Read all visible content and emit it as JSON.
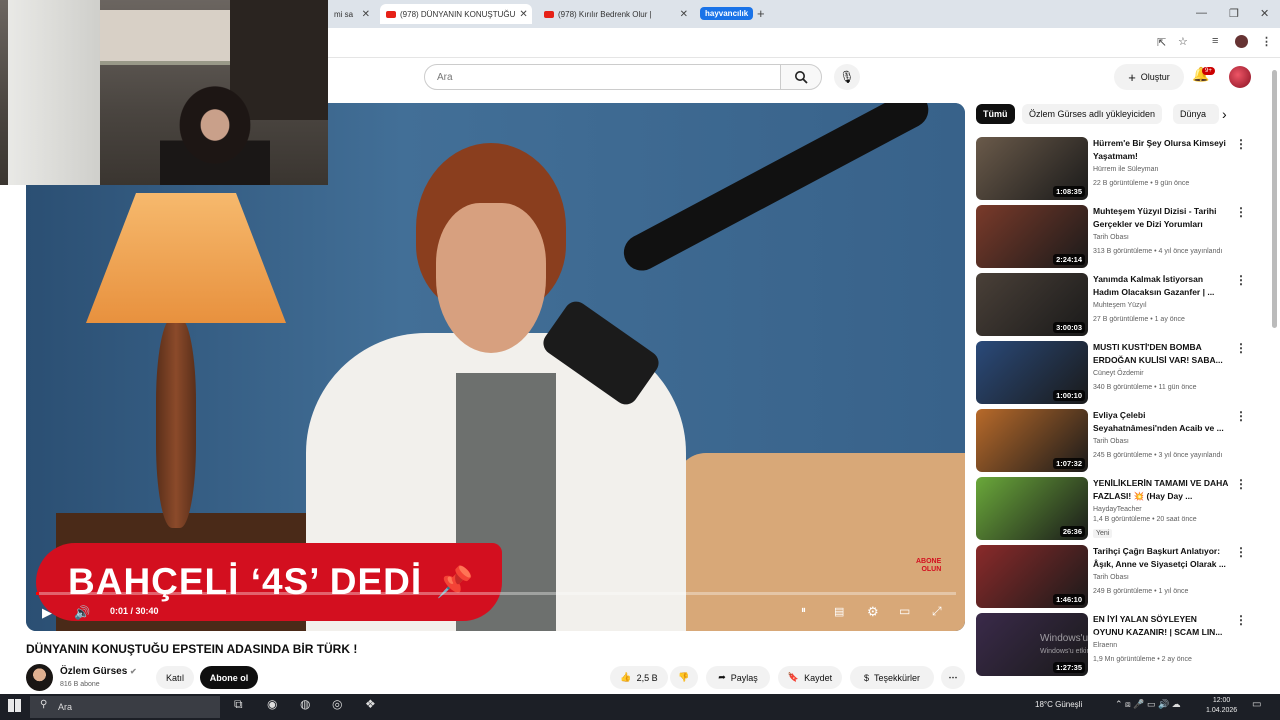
{
  "browser": {
    "tabs": [
      {
        "label": "mi sa"
      },
      {
        "label": "(978) DÜNYANIN KONUŞTUĞU"
      },
      {
        "label": "(978) Kırılır Bedrenk Olur |"
      }
    ],
    "tab_group": "hayvancılık"
  },
  "header": {
    "search_placeholder": "Ara",
    "create_label": "Oluştur",
    "notifications_badge": "9+"
  },
  "video": {
    "banner_text": "BAHÇELİ ‘4S’ DEDİ",
    "abone_line1": "ABONE",
    "abone_line2": "OLUN",
    "time": "0:01 / 30:40",
    "progress_percent": 0.3
  },
  "info": {
    "title": "DÜNYANIN KONUŞTUĞU EPSTEIN ADASINDA BİR TÜRK !",
    "channel": "Özlem Gürses",
    "subscribers": "816 B abone",
    "join_label": "Katıl",
    "subscribe_label": "Abone ol",
    "likes": "2,5 B",
    "share_label": "Paylaş",
    "save_label": "Kaydet",
    "thanks_label": "Teşekkürler"
  },
  "chips": [
    "Tümü",
    "Özlem Gürses adlı yükleyiciden",
    "Dünya"
  ],
  "recommendations": [
    {
      "title": "Hürrem'e Bir Şey Olursa Kimseyi Yaşatmam!",
      "channel": "Hürrem ile Süleyman",
      "meta": "22 B görüntüleme • 9 gün önce",
      "duration": "1:08:35",
      "color": "#6a5a4a"
    },
    {
      "title": "Muhteşem Yüzyıl Dizisi - Tarihi Gerçekler ve Dizi Yorumları",
      "channel": "Tarih Obası",
      "meta": "313 B görüntüleme • 4 yıl önce yayınlandı",
      "duration": "2:24:14",
      "color": "#7a3a2a"
    },
    {
      "title": "Yanımda Kalmak İstiyorsan Hadım Olacaksın Gazanfer | ...",
      "channel": "Muhteşem Yüzyıl",
      "meta": "27 B görüntüleme • 1 ay önce",
      "duration": "3:00:03",
      "color": "#4a4038"
    },
    {
      "title": "MUSTI KUSTİ'DEN BOMBA ERDOĞAN KULİSİ VAR! SABA...",
      "channel": "Cüneyt Özdemir",
      "meta": "340 B görüntüleme • 11 gün önce",
      "duration": "1:00:10",
      "color": "#2a4a7a"
    },
    {
      "title": "Evliya Çelebi Seyahatnâmesi'nden Acaib ve ...",
      "channel": "Tarih Obası",
      "meta": "245 B görüntüleme • 3 yıl önce yayınlandı",
      "duration": "1:07:32",
      "color": "#b86a2a"
    },
    {
      "title": "YENİLİKLERİN TAMAMI VE DAHA FAZLASI! 💥 (Hay Day ...",
      "channel": "HaydayTeacher",
      "meta": "1,4 B görüntüleme • 20 saat önce",
      "duration": "26:36",
      "color": "#6aa83a",
      "badge": "Yeni"
    },
    {
      "title": "Tarihçi Çağrı Başkurt Anlatıyor: Âşık, Anne ve Siyasetçi Olarak ...",
      "channel": "Tarih Obası",
      "meta": "249 B görüntüleme • 1 yıl önce",
      "duration": "1:46:10",
      "color": "#8a2a2a"
    },
    {
      "title": "EN İYİ YALAN SÖYLEYEN OYUNU KAZANIR! | SCAM LIN...",
      "channel": "Elraenn",
      "meta": "1,9 Mn görüntüleme • 2 ay önce",
      "duration": "1:27:35",
      "color": "#3a2a4a"
    }
  ],
  "windows": {
    "watermark": "Windows'u Etkinleştir",
    "watermark2": "Windows'u etkinleştirmek için Ayarlar'a gidin.",
    "search_placeholder": "Ara",
    "weather": "18°C  Güneşli",
    "time": "12:00",
    "date": "1.04.2026"
  }
}
